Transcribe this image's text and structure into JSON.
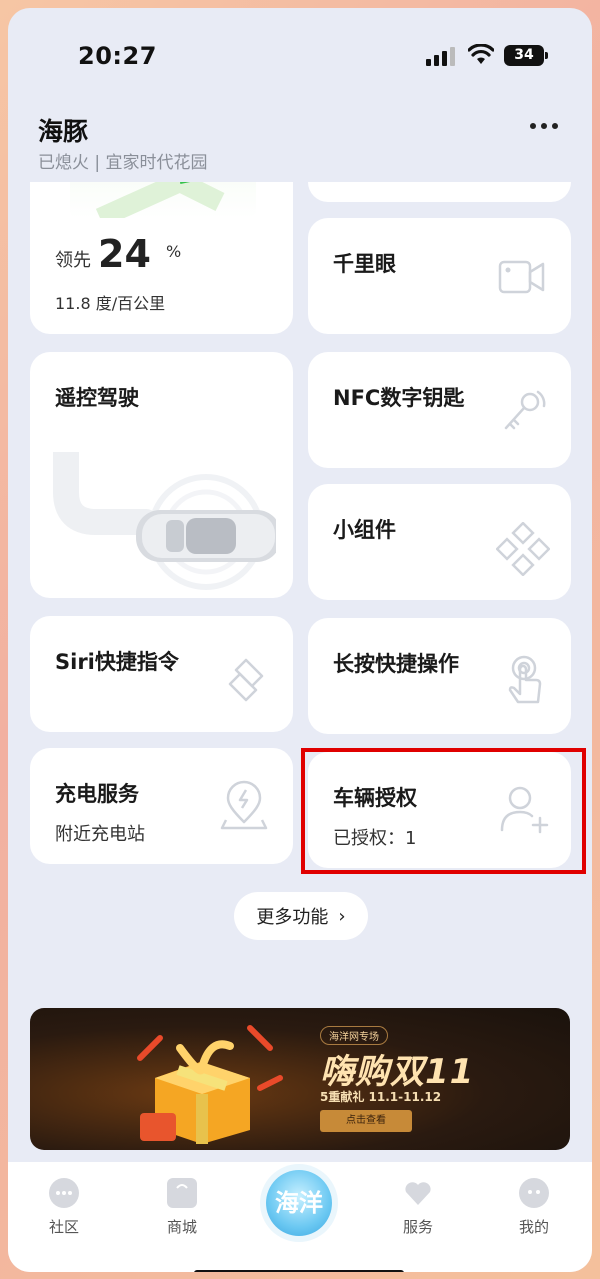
{
  "status_bar": {
    "time": "20:27",
    "battery": "34"
  },
  "header": {
    "title": "海豚",
    "subtitle": "已熄火 | 宜家时代花园"
  },
  "cards": {
    "efficiency": {
      "lead_label": "领先",
      "lead_value": "24",
      "lead_unit": "%",
      "consumption": "11.8 度/百公里"
    },
    "thousand_eye": {
      "label": "千里眼"
    },
    "remote_drive": {
      "label": "遥控驾驶"
    },
    "nfc_key": {
      "label": "NFC数字钥匙"
    },
    "widget": {
      "label": "小组件"
    },
    "siri": {
      "label": "Siri快捷指令"
    },
    "long_press": {
      "label": "长按快捷操作"
    },
    "charging": {
      "label": "充电服务",
      "sub": "附近充电站"
    },
    "authorization": {
      "label": "车辆授权",
      "sub": "已授权：1"
    }
  },
  "more_functions": {
    "label": "更多功能",
    "chevron": "›"
  },
  "banner": {
    "tag": "海洋网专场",
    "title": "嗨购双11",
    "subtitle": "5重献礼 11.1-11.12",
    "button": "点击查看"
  },
  "tabbar": {
    "items": [
      {
        "label": "社区",
        "icon": "chat-icon"
      },
      {
        "label": "商城",
        "icon": "bag-icon"
      },
      {
        "label": "海洋",
        "icon": "ocean-logo-icon"
      },
      {
        "label": "服务",
        "icon": "heart-icon"
      },
      {
        "label": "我的",
        "icon": "face-icon"
      }
    ]
  },
  "colors": {
    "background": "#e8ebf5",
    "card": "#ffffff",
    "highlight": "#e00000",
    "banner_gold": "#ffe3b0"
  }
}
